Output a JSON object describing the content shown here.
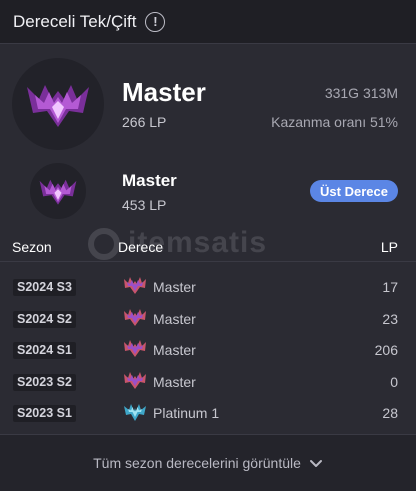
{
  "header": {
    "title": "Dereceli Tek/Çift",
    "info_icon": "info-icon"
  },
  "current": {
    "tier": "Master",
    "lp": "266 LP",
    "record": "331G 313M",
    "winrate": "Kazanma oranı 51%",
    "emblem_icon": "master-emblem-icon"
  },
  "peak": {
    "tier": "Master",
    "lp": "453 LP",
    "badge": "Üst Derece",
    "emblem_icon": "master-emblem-icon"
  },
  "table": {
    "headers": {
      "season": "Sezon",
      "rank": "Derece",
      "lp": "LP"
    },
    "rows": [
      {
        "season": "S2024 S3",
        "tier": "Master",
        "lp": "17",
        "icon": "master-icon"
      },
      {
        "season": "S2024 S2",
        "tier": "Master",
        "lp": "23",
        "icon": "master-icon"
      },
      {
        "season": "S2024 S1",
        "tier": "Master",
        "lp": "206",
        "icon": "master-icon"
      },
      {
        "season": "S2023 S2",
        "tier": "Master",
        "lp": "0",
        "icon": "master-icon"
      },
      {
        "season": "S2023 S1",
        "tier": "Platinum 1",
        "lp": "28",
        "icon": "platinum-icon"
      }
    ]
  },
  "watermark": "itemsatis",
  "footer": {
    "label": "Tüm sezon derecelerini görüntüle",
    "icon": "chevron-down-icon"
  },
  "colors": {
    "accent": "#5b86e5",
    "background": "#2b2b33",
    "header": "#1f1f25"
  }
}
